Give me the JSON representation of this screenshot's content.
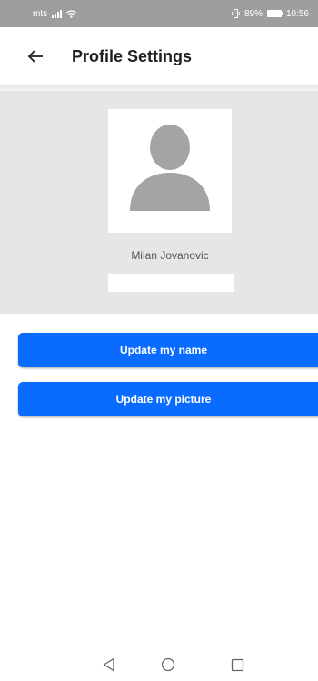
{
  "status_bar": {
    "carrier": "mts",
    "battery_percent": "89%",
    "time": "10:56",
    "icons": [
      "signal-icon",
      "wifi-icon",
      "vibrate-icon",
      "battery-icon"
    ]
  },
  "header": {
    "title": "Profile Settings",
    "back_icon": "arrow-left-icon"
  },
  "profile": {
    "avatar_icon": "person-silhouette-icon",
    "name": "Milan Jovanovic",
    "name_field_value": ""
  },
  "actions": {
    "update_name_label": "Update my name",
    "update_picture_label": "Update my picture"
  },
  "nav": {
    "icons": [
      "nav-back-icon",
      "nav-home-icon",
      "nav-recents-icon"
    ]
  },
  "colors": {
    "accent": "#0a6cff",
    "status_bar": "#9e9e9e",
    "panel": "#e6e6e6",
    "avatar_silhouette": "#a4a4a4"
  }
}
